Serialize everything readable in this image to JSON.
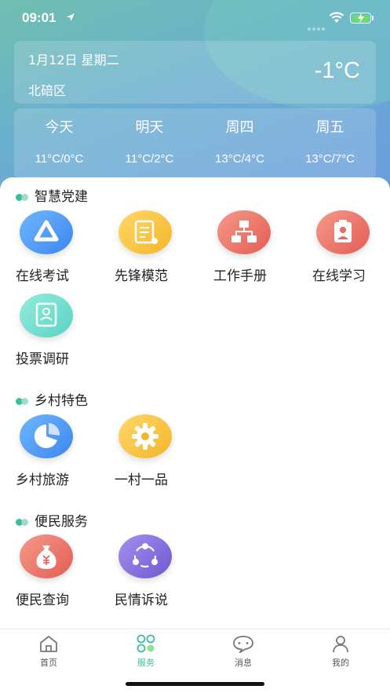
{
  "status_bar": {
    "time": "09:01"
  },
  "weather": {
    "date": "1月12日  星期二",
    "district": "北碚区",
    "current_temp": "-1°C",
    "forecast": [
      {
        "day": "今天",
        "range": "11°C/0°C"
      },
      {
        "day": "明天",
        "range": "11°C/2°C"
      },
      {
        "day": "周四",
        "range": "13°C/4°C"
      },
      {
        "day": "周五",
        "range": "13°C/7°C"
      }
    ]
  },
  "sections": [
    {
      "title": "智慧党建",
      "items": [
        {
          "label": "在线考试",
          "icon": "exam-icon",
          "color": "#3d86ee"
        },
        {
          "label": "先锋模范",
          "icon": "document-gear-icon",
          "color": "#f3b52a"
        },
        {
          "label": "工作手册",
          "icon": "workflow-icon",
          "color": "#e45c55"
        },
        {
          "label": "在线学习",
          "icon": "id-card-icon",
          "color": "#e45c55"
        },
        {
          "label": "投票调研",
          "icon": "survey-book-icon",
          "color": "#5cd3c2"
        }
      ]
    },
    {
      "title": "乡村特色",
      "items": [
        {
          "label": "乡村旅游",
          "icon": "pie-chart-icon",
          "color": "#3d86ee"
        },
        {
          "label": "一村一品",
          "icon": "gear-icon",
          "color": "#f3b52a"
        }
      ]
    },
    {
      "title": "便民服务",
      "items": [
        {
          "label": "便民查询",
          "icon": "money-bag-icon",
          "color": "#e45c55"
        },
        {
          "label": "民情诉说",
          "icon": "share-icon",
          "color": "#6e58d2"
        }
      ]
    }
  ],
  "tabs": [
    {
      "label": "首页",
      "icon": "home-icon",
      "active": false
    },
    {
      "label": "服务",
      "icon": "services-icon",
      "active": true
    },
    {
      "label": "消息",
      "icon": "message-icon",
      "active": false
    },
    {
      "label": "我的",
      "icon": "profile-icon",
      "active": false
    }
  ],
  "colors": {
    "accent": "#3bbf9a",
    "hero_top": "#6fbfb0",
    "hero_bottom": "#6b9be0"
  }
}
